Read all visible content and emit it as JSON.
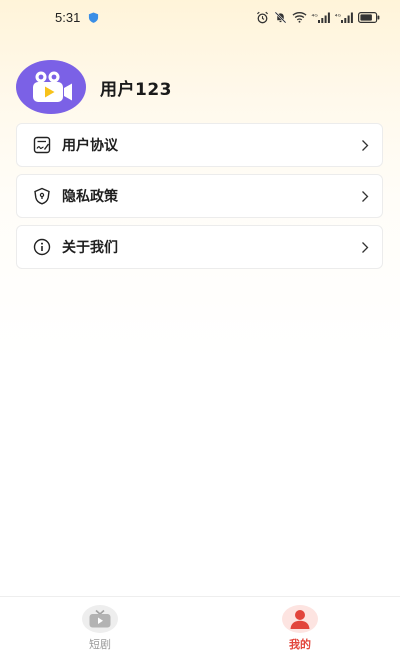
{
  "status_bar": {
    "time": "5:31",
    "network_1": "⁴ᴳ",
    "network_2": "⁴ᴳ"
  },
  "profile": {
    "username": "用户123"
  },
  "menu": {
    "items": [
      {
        "label": "用户协议",
        "icon": "document-sign-icon"
      },
      {
        "label": "隐私政策",
        "icon": "shield-lock-icon"
      },
      {
        "label": "关于我们",
        "icon": "info-icon"
      }
    ]
  },
  "tabbar": {
    "tabs": [
      {
        "label": "短剧",
        "icon": "tv-icon",
        "active": false
      },
      {
        "label": "我的",
        "icon": "person-icon",
        "active": true
      }
    ]
  },
  "colors": {
    "accent": "#e2453c",
    "avatar_bg": "#7b61e6",
    "header_gradient_top": "#fff4d9"
  }
}
